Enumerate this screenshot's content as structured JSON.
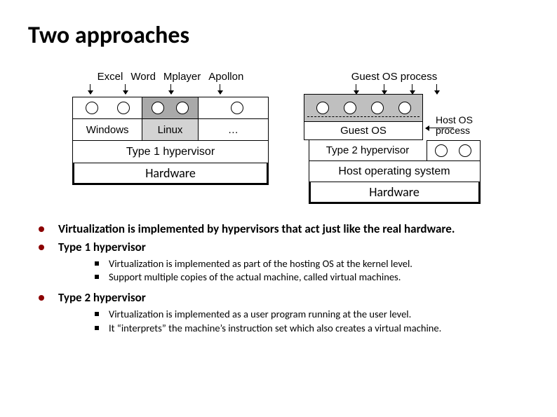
{
  "title": "Two approaches",
  "left": {
    "apps": [
      "Excel",
      "Word",
      "Mplayer",
      "Apollon"
    ],
    "os": [
      "Windows",
      "Linux",
      "…"
    ],
    "hypervisor": "Type 1 hypervisor",
    "hardware": "Hardware"
  },
  "right": {
    "guest_process": "Guest OS process",
    "host_process": "Host OS process",
    "guest_os": "Guest OS",
    "hypervisor": "Type 2 hypervisor",
    "host_os": "Host operating system",
    "hardware": "Hardware"
  },
  "bullets": [
    {
      "text": "Virtualization is implemented by hypervisors that act just like the real hardware.",
      "bold": true,
      "sub": []
    },
    {
      "text": "Type 1 hypervisor",
      "bold": true,
      "sub": [
        "Virtualization is implemented as part of the hosting OS at the kernel level.",
        "Support multiple copies of the actual machine, called virtual machines."
      ]
    },
    {
      "text": "Type 2 hypervisor",
      "bold": true,
      "sub": [
        "Virtualization is implemented as a user program running at the user level.",
        "It “interprets” the machine’s instruction set which also creates a virtual machine."
      ]
    }
  ]
}
